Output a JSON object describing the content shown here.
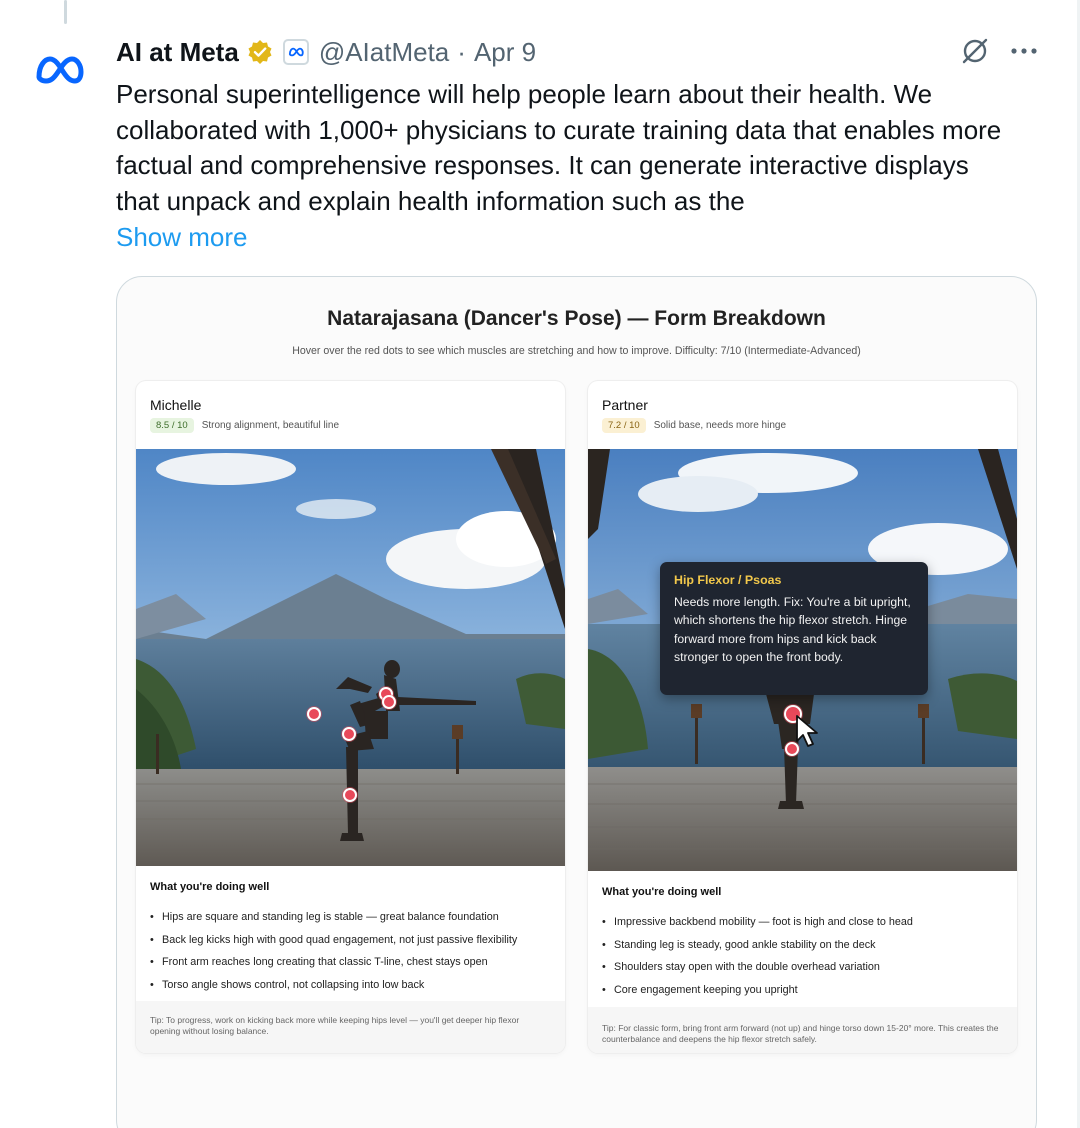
{
  "tweet": {
    "author_name": "AI at Meta",
    "handle": "@AIatMeta",
    "separator": "·",
    "date": "Apr 9",
    "text": "Personal superintelligence will help people learn about their health. We collaborated with 1,000+ physicians to curate training data that enables more factual and comprehensive responses. It can generate interactive displays that unpack and explain health information such as the",
    "show_more": "Show more",
    "icons": {
      "avatar": "meta-logo-icon",
      "verified": "gold-verified-badge-icon",
      "affiliate": "meta-affiliate-badge-icon",
      "grok": "grok-icon",
      "more": "more-horizontal-icon"
    },
    "colors": {
      "link": "#1d9bf0",
      "meta_blue": "#0866ff",
      "verified_gold": "#e2b719"
    }
  },
  "media": {
    "title": "Natarajasana (Dancer's Pose) — Form Breakdown",
    "subtitle": "Hover over the red dots to see which muscles are stretching and how to improve. Difficulty: 7/10 (Intermediate-Advanced)",
    "cards": [
      {
        "person": "Michelle",
        "score": "8.5 / 10",
        "score_note": "Strong alignment, beautiful line",
        "section_title": "What you're doing well",
        "bullets": [
          "Hips are square and standing leg is stable — great balance foundation",
          "Back leg kicks high with good quad engagement, not just passive flexibility",
          "Front arm reaches long creating that classic T-line, chest stays open",
          "Torso angle shows control, not collapsing into low back"
        ],
        "tip": "Tip: To progress, work on kicking back more while keeping hips level — you'll get deeper hip flexor opening without losing balance."
      },
      {
        "person": "Partner",
        "score": "7.2 / 10",
        "score_note": "Solid base, needs more hinge",
        "section_title": "What you're doing well",
        "bullets": [
          "Impressive backbend mobility — foot is high and close to head",
          "Standing leg is steady, good ankle stability on the deck",
          "Shoulders stay open with the double overhead variation",
          "Core engagement keeping you upright"
        ],
        "tip": "Tip: For classic form, bring front arm forward (not up) and hinge torso down 15-20° more. This creates the counterbalance and deepens the hip flexor stretch safely.",
        "tooltip": {
          "title": "Hip Flexor / Psoas",
          "body": "Needs more length. Fix: You're a bit upright, which shortens the hip flexor stretch. Hinge forward more from hips and kick back stronger to open the front body."
        }
      }
    ]
  }
}
